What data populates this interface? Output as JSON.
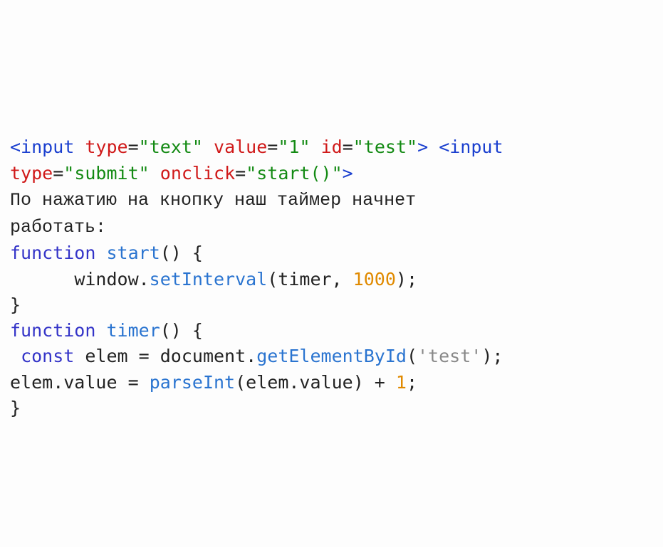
{
  "code": {
    "html_line1": {
      "open1": "<input",
      "a_type": "type",
      "v_type": "\"text\"",
      "a_value": "value",
      "v_value": "\"1\"",
      "a_id": "id",
      "v_id": "\"test\"",
      "gt1": ">",
      "open2": "<input"
    },
    "html_line2": {
      "a_type": "type",
      "v_type": "\"submit\"",
      "a_onclick": "onclick",
      "v_onclick": "\"start()\"",
      "gt": ">"
    },
    "prose_line1": "По нажатию на кнопку наш таймер начнет",
    "prose_line2": "работать:",
    "fn_start": {
      "kw": "function",
      "name": "start",
      "sig_open": "() {",
      "indent": "      ",
      "obj": "window.",
      "call": "setInterval",
      "args_open": "(timer, ",
      "num": "1000",
      "args_close": ");",
      "close": "}"
    },
    "fn_timer": {
      "kw": "function",
      "name": "timer",
      "sig_open": "() {",
      "l2_indent": " ",
      "l2_kw": "const",
      "l2_lhs": " elem ",
      "l2_eq": "=",
      "l2_rhs1": " document.",
      "l2_call": "getElementById",
      "l2_open": "(",
      "l2_lit": "'test'",
      "l2_close": ");",
      "l3_lhs": "elem.value ",
      "l3_eq": "=",
      "l3_sp": " ",
      "l3_call": "parseInt",
      "l3_arg": "(elem.value) + ",
      "l3_num": "1",
      "l3_end": ";",
      "close": "}"
    }
  }
}
